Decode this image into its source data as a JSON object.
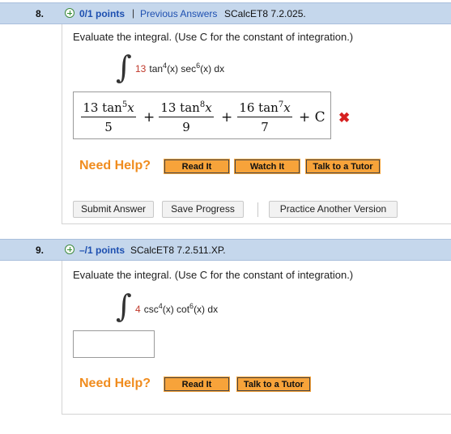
{
  "q1": {
    "number": "8.",
    "points": "0/1 points",
    "separator": "|",
    "previous_answers": "Previous Answers",
    "code": "SCalcET8 7.2.025.",
    "prompt": "Evaluate the integral. (Use C for the constant of integration.)",
    "integrand": {
      "coef": "13",
      "f1": "tan",
      "e1": "4",
      "f2": "(x) sec",
      "e2": "6",
      "tail": "(x) dx"
    },
    "answer": {
      "t1_num": "13 tan",
      "t1_exp": "5",
      "t1_var": "x",
      "t1_den": "5",
      "op1": "+",
      "t2_num": "13 tan",
      "t2_exp": "8",
      "t2_var": "x",
      "t2_den": "9",
      "op2": "+",
      "t3_num": "16 tan",
      "t3_exp": "7",
      "t3_var": "x",
      "t3_den": "7",
      "tail": "+ C",
      "status_icon": "✖"
    },
    "need_help": "Need Help?",
    "help_buttons": [
      "Read It",
      "Watch It",
      "Talk to a Tutor"
    ],
    "actions": [
      "Submit Answer",
      "Save Progress",
      "Practice Another Version"
    ]
  },
  "q2": {
    "number": "9.",
    "points": "–/1 points",
    "code": "SCalcET8 7.2.511.XP.",
    "prompt": "Evaluate the integral. (Use C for the constant of integration.)",
    "integrand": {
      "coef": "4",
      "f1": "csc",
      "e1": "4",
      "f2": "(x) cot",
      "e2": "6",
      "tail": "(x) dx"
    },
    "need_help": "Need Help?",
    "help_buttons": [
      "Read It",
      "Talk to a Tutor"
    ]
  },
  "colors": {
    "header_bg": "#c5d7ec",
    "link": "#1d4fb0",
    "help_orange": "#f08c1e",
    "wrong": "#d62020"
  }
}
